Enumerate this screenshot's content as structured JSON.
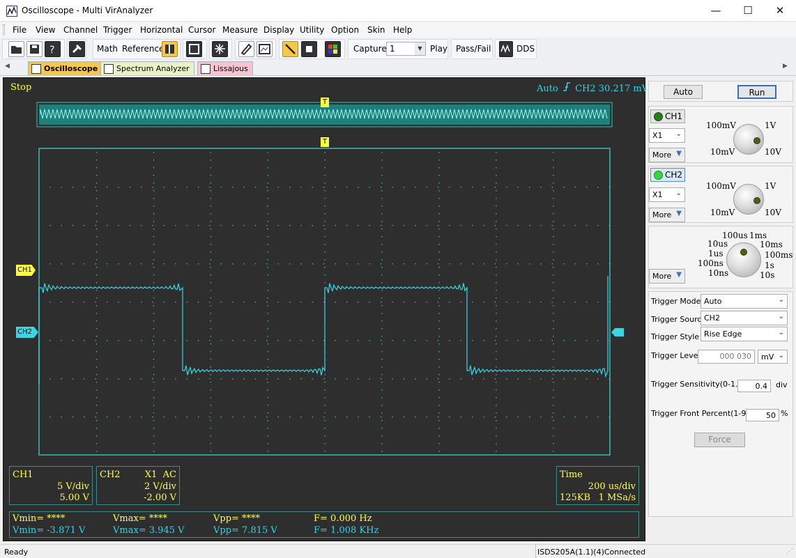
{
  "window": {
    "title": "Oscilloscope - Multi VirAnalyzer",
    "minimize": "—",
    "maximize": "☐",
    "close": "✕"
  },
  "menu": {
    "items": [
      "File",
      "View",
      "Channel",
      "Trigger",
      "Horizontal",
      "Cursor",
      "Measure",
      "Display",
      "Utility",
      "Option",
      "Skin",
      "Help"
    ]
  },
  "toolbar": {
    "math": "Math",
    "reference": "Reference",
    "capture_label": "Capture",
    "capture_value": "1",
    "play": "Play",
    "passfail": "Pass/Fail",
    "dds": "DDS"
  },
  "tabs": [
    {
      "label": "Oscilloscope",
      "active": true
    },
    {
      "label": "Spectrum Analyzer",
      "active": false
    },
    {
      "label": "Lissajous",
      "active": false
    }
  ],
  "scope": {
    "state": "Stop",
    "trigger_readout": "Auto",
    "trigger_channel_level": "CH2 30.217 mV",
    "trigger_marker": "T",
    "ch1_marker": "CH1",
    "ch2_marker": "CH2",
    "colors": {
      "background": "#2e2e2e",
      "grid": "#3fb9b0",
      "trace": "#39d6e6",
      "label": "#ffff44"
    }
  },
  "ch1_info": {
    "name": "CH1",
    "vdiv": "5 V/div",
    "offset": "5.00 V"
  },
  "ch2_info": {
    "name": "CH2",
    "mode": "X1  AC",
    "vdiv": "2 V/div",
    "offset": "-2.00 V"
  },
  "time_info": {
    "name": "Time",
    "tdiv": "200 us/div",
    "memory": "125KB",
    "rate": "1 MSa/s"
  },
  "measurements": {
    "row1": {
      "vmin": "Vmin= ****",
      "vmax": "Vmax= ****",
      "vpp": "Vpp= ****",
      "freq": "F= 0.000 Hz"
    },
    "row2": {
      "vmin": "Vmin= -3.871 V",
      "vmax": "Vmax= 3.945 V",
      "vpp": "Vpp= 7.815 V",
      "freq": "F= 1.008 KHz"
    }
  },
  "panel": {
    "auto": "Auto",
    "run": "Run",
    "ch1": {
      "label": "CH1",
      "probe": "X1",
      "more": "More",
      "k_tl": "100mV",
      "k_tr": "1V",
      "k_bl": "10mV",
      "k_br": "10V"
    },
    "ch2": {
      "label": "CH2",
      "probe": "X1",
      "more": "More",
      "k_tl": "100mV",
      "k_tr": "1V",
      "k_bl": "10mV",
      "k_br": "10V"
    },
    "time": {
      "more": "More",
      "labels": [
        "100us",
        "1ms",
        "10us",
        "10ms",
        "1us",
        "100ms",
        "100ns",
        "1s",
        "10ns",
        "10s"
      ]
    },
    "trigger_mode_label": "Trigger Mode",
    "trigger_mode": "Auto",
    "trigger_source_label": "Trigger Source",
    "trigger_source": "CH2",
    "trigger_style_label": "Trigger Style",
    "trigger_style": "Rise Edge",
    "trigger_level_label": "Trigger Level",
    "trigger_level": "000 030",
    "trigger_level_unit": "mV",
    "sensitivity_label": "Trigger Sensitivity(0-1.0)",
    "sensitivity": "0.4",
    "sensitivity_unit": "div",
    "front_label": "Trigger Front Percent(1-99)",
    "front": "50",
    "front_unit": "%",
    "force": "Force"
  },
  "status": {
    "left": "Ready",
    "right": "ISDS205A(1.1)(4)Connected"
  }
}
